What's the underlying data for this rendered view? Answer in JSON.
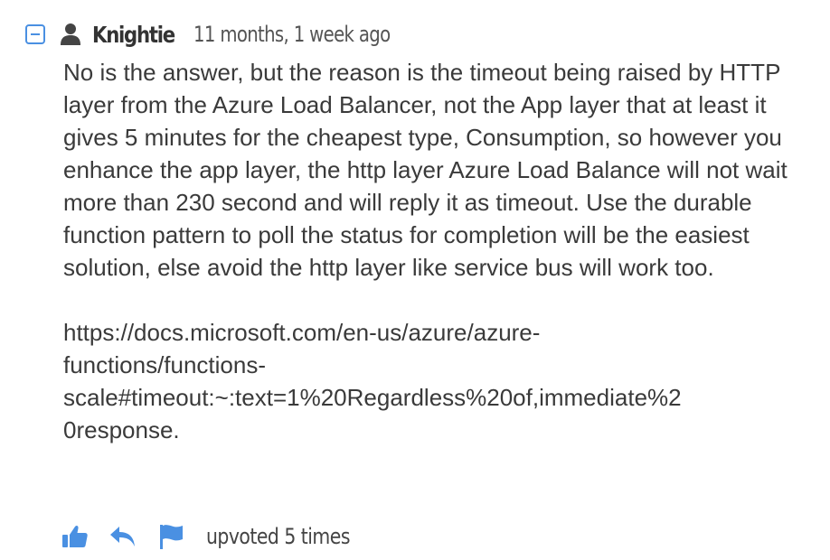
{
  "comment": {
    "author": "Knightie",
    "timestamp": "11 months, 1 week ago",
    "paragraphs": [
      "No is the answer, but the reason is the timeout being raised by HTTP layer from the Azure Load Balancer, not the App layer that at least it gives 5 minutes for the cheapest type, Consumption, so however you enhance the app layer, the http layer Azure Load Balance will not wait more than 230 second and will reply it as timeout. Use the durable function pattern to poll the status for completion will be the easiest solution, else avoid the http layer like service bus will work too."
    ],
    "link_lines": [
      "https://docs.microsoft.com/en-us/azure/azure-",
      "functions/functions-",
      "scale#timeout:~:text=1%20Regardless%20of,immediate%2",
      "0response."
    ],
    "upvote_text": "upvoted 5 times"
  },
  "icons": {
    "collapse": "minus-square-icon",
    "user": "user-icon",
    "upvote": "thumbs-up-icon",
    "reply": "reply-icon",
    "flag": "flag-icon"
  },
  "colors": {
    "accent": "#4a90e2",
    "text": "#3a3a3a",
    "author": "#333333"
  }
}
